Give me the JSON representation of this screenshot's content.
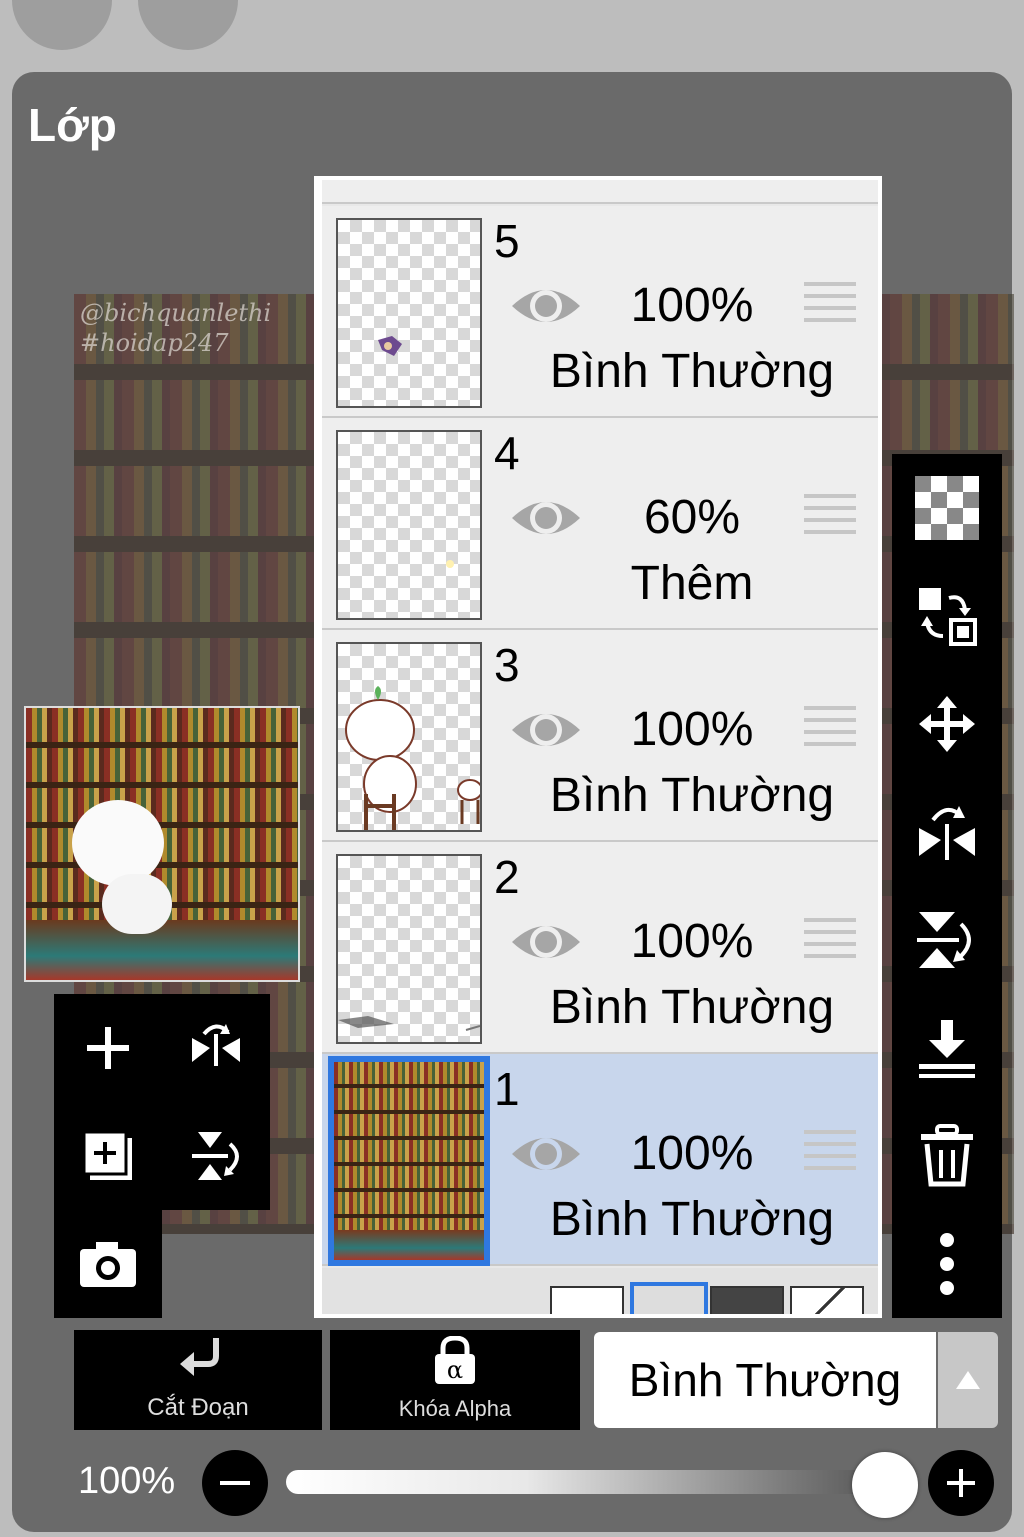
{
  "panel": {
    "title": "Lớp"
  },
  "canvas": {
    "watermark_line1": "@bichquanlethi",
    "watermark_line2": "#hoidap247"
  },
  "layers": [
    {
      "number": "5",
      "opacity": "100%",
      "blend_mode": "Bình Thường",
      "visible": true,
      "selected": false
    },
    {
      "number": "4",
      "opacity": "60%",
      "blend_mode": "Thêm",
      "visible": true,
      "selected": false
    },
    {
      "number": "3",
      "opacity": "100%",
      "blend_mode": "Bình Thường",
      "visible": true,
      "selected": false
    },
    {
      "number": "2",
      "opacity": "100%",
      "blend_mode": "Bình Thường",
      "visible": true,
      "selected": false
    },
    {
      "number": "1",
      "opacity": "100%",
      "blend_mode": "Bình Thường",
      "visible": true,
      "selected": true
    }
  ],
  "bottom_bar": {
    "clip_label": "Cắt Đoạn",
    "alpha_lock_label": "Khóa Alpha",
    "blend_mode_value": "Bình Thường"
  },
  "opacity": {
    "label": "100%",
    "value": 1.0
  },
  "colors": {
    "selected_row": "#c8d6ec",
    "selected_border": "#2f78e0"
  }
}
